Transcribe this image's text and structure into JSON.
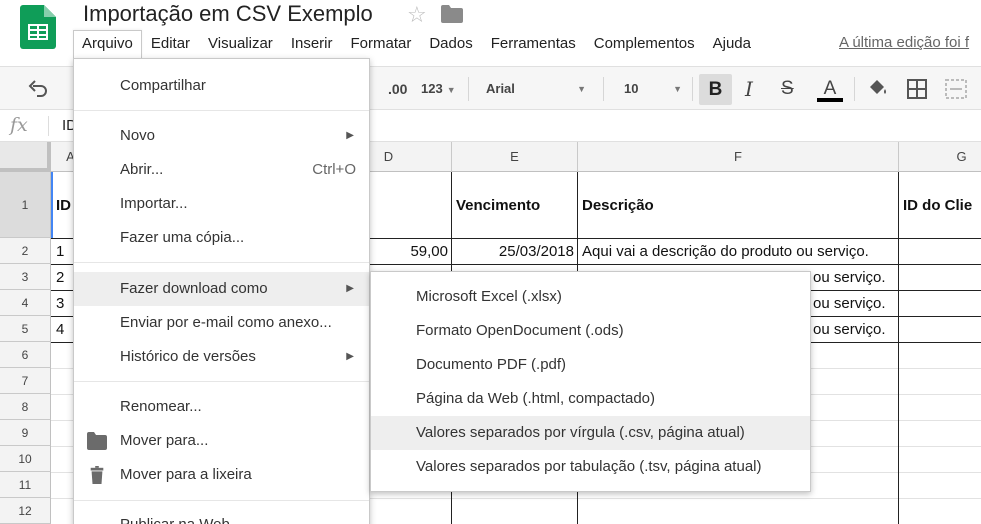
{
  "app": {
    "doc_title": "Importação em CSV Exemplo",
    "last_edit": "A última edição foi f"
  },
  "menubar": [
    "Arquivo",
    "Editar",
    "Visualizar",
    "Inserir",
    "Formatar",
    "Dados",
    "Ferramentas",
    "Complementos",
    "Ajuda"
  ],
  "toolbar": {
    "decimal_label": ".00",
    "format_label": "123",
    "font_name": "Arial",
    "font_size": "10",
    "bold_label": "B",
    "italic_label": "I",
    "strike_label": "S",
    "textcolor_label": "A"
  },
  "formula_bar": {
    "fx_label": "fx",
    "content": "ID"
  },
  "grid": {
    "col_headers": [
      "A",
      "D",
      "E",
      "F",
      "G"
    ],
    "row_headers": [
      "1",
      "2",
      "3",
      "4",
      "5",
      "6",
      "7",
      "8",
      "9",
      "10",
      "11",
      "12"
    ],
    "header_row": {
      "a": "ID",
      "e": "Vencimento",
      "f": "Descrição",
      "g": "ID do Clie"
    },
    "rows": [
      {
        "a": "1",
        "d": "59,00",
        "e": "25/03/2018",
        "f": "Aqui vai a descrição do produto ou serviço."
      },
      {
        "a": "2",
        "f_tail": "ou serviço."
      },
      {
        "a": "3",
        "f_tail": "ou serviço."
      },
      {
        "a": "4",
        "f_tail": "ou serviço."
      }
    ]
  },
  "file_menu": {
    "share": "Compartilhar",
    "new": "Novo",
    "open": "Abrir...",
    "open_shortcut": "Ctrl+O",
    "import": "Importar...",
    "copy": "Fazer uma cópia...",
    "download": "Fazer download como",
    "email": "Enviar por e-mail como anexo...",
    "history": "Histórico de versões",
    "rename": "Renomear...",
    "move": "Mover para...",
    "trash": "Mover para a lixeira",
    "publish": "Publicar na Web..."
  },
  "download_submenu": {
    "xlsx": "Microsoft Excel (.xlsx)",
    "ods": "Formato OpenDocument (.ods)",
    "pdf": "Documento PDF (.pdf)",
    "html": "Página da Web (.html, compactado)",
    "csv": "Valores separados por vírgula (.csv, página atual)",
    "tsv": "Valores separados por tabulação (.tsv, página atual)"
  },
  "colors": {
    "brand_green": "#0f9d58",
    "selection_blue": "#4285f4",
    "hover_gray": "#eeeeee"
  }
}
